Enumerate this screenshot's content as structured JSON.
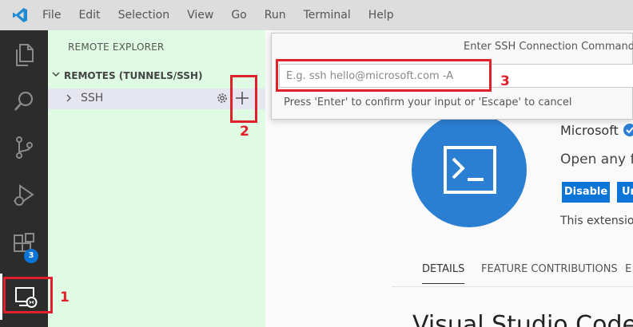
{
  "menu": [
    "File",
    "Edit",
    "Selection",
    "View",
    "Go",
    "Run",
    "Terminal",
    "Help"
  ],
  "activity_bar": {
    "items": [
      {
        "icon": "files-icon"
      },
      {
        "icon": "search-icon"
      },
      {
        "icon": "source-control-icon"
      },
      {
        "icon": "run-debug-icon"
      },
      {
        "icon": "extensions-icon",
        "badge": "3"
      },
      {
        "icon": "remote-explorer-icon",
        "active": true
      }
    ]
  },
  "sidebar": {
    "title": "REMOTE EXPLORER",
    "section_title": "REMOTES (TUNNELS/SSH)",
    "items": [
      {
        "label": "SSH"
      }
    ]
  },
  "quick_input": {
    "title": "Enter SSH Connection Command",
    "placeholder": "E.g. ssh hello@microsoft.com -A",
    "hint": "Press 'Enter' to confirm your input or 'Escape' to cancel"
  },
  "extension": {
    "publisher": "Microsoft",
    "description": "Open any fo",
    "disable_label": "Disable",
    "second_button_label": "Ur",
    "note": "This extension",
    "tabs": [
      "DETAILS",
      "FEATURE CONTRIBUTIONS",
      "E"
    ],
    "heading": "Visual Studio Code"
  },
  "callouts": [
    "1",
    "2",
    "3"
  ],
  "colors": {
    "menubar": "#dddddd",
    "activity_bar": "#2c2c2c",
    "sidebar": "#dffbe4",
    "accent": "#0b74d7",
    "callout": "#e0202a"
  }
}
